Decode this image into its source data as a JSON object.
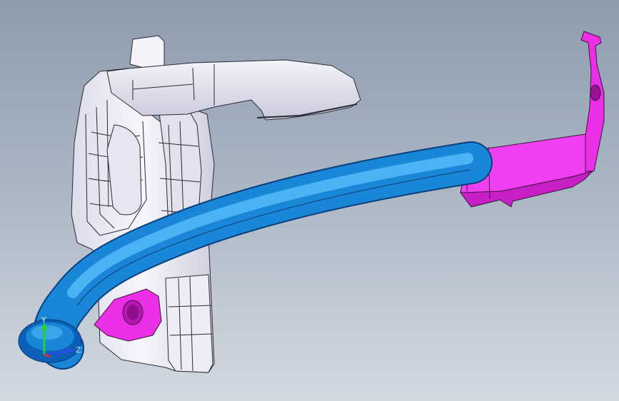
{
  "viewport": {
    "background_top": "#8e9cae",
    "background_bottom": "#d3d9e1"
  },
  "parts": {
    "bracket_color": "#ecebf4",
    "tube_color": "#1a86d8",
    "clip_color": "#ea2fe6"
  },
  "triad": {
    "axis_y_label": "Y",
    "axis_z_label": "Z",
    "axis_y_color": "#1fd52a",
    "axis_x_color": "#e03030",
    "axis_z_color": "#2850e8"
  }
}
